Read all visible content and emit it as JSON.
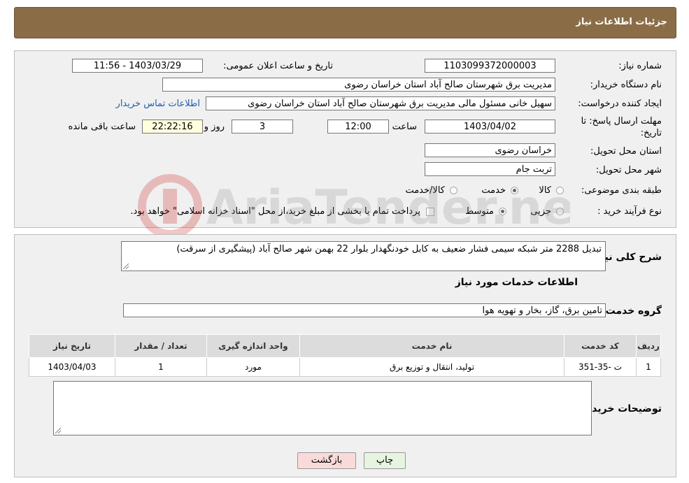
{
  "header": {
    "title": "جزئیات اطلاعات نیاز"
  },
  "form": {
    "need_number": {
      "label": "شماره نیاز:",
      "value": "1103099372000003"
    },
    "announce_datetime": {
      "label": "تاریخ و ساعت اعلان عمومی:",
      "value": "1403/03/29 - 11:56"
    },
    "buyer_org": {
      "label": "نام دستگاه خریدار:",
      "value": "مدیریت برق شهرستان صالح آباد استان خراسان رضوی"
    },
    "requester": {
      "label": "ایجاد کننده درخواست:",
      "value": "سهیل خانی مسئول مالی مدیریت برق شهرستان صالح آباد استان خراسان رضوی",
      "contact_link": "اطلاعات تماس خریدار"
    },
    "deadline": {
      "label": "مهلت ارسال پاسخ: تا تاریخ:",
      "date": "1403/04/02",
      "time_label": "ساعت",
      "time": "12:00",
      "days": "3",
      "days_label": "روز و",
      "remaining": "22:22:16",
      "remaining_label": "ساعت باقی مانده"
    },
    "delivery_province": {
      "label": "استان محل تحویل:",
      "value": "خراسان رضوی"
    },
    "delivery_city": {
      "label": "شهر محل تحویل:",
      "value": "تربت جام"
    },
    "category": {
      "label": "طبقه بندی موضوعی:",
      "options": [
        "کالا",
        "خدمت",
        "کالا/خدمت"
      ],
      "selected": "خدمت"
    },
    "purchase_process": {
      "label": "نوع فرآیند خرید :",
      "options": [
        "جزیی",
        "متوسط"
      ],
      "selected": "متوسط",
      "note": "پرداخت تمام یا بخشی از مبلغ خرید،از محل \"اسناد خزانه اسلامی\" خواهد بود."
    }
  },
  "details": {
    "description_label": "شرح کلی نیاز:",
    "description": "تبدیل 2288 متر شبکه سیمی فشار ضعیف به کابل خودنگهدار بلوار 22 بهمن شهر صالح آباد (پیشگیری از سرقت)",
    "services_title": "اطلاعات خدمات مورد نیاز",
    "service_group_label": "گروه خدمت:",
    "service_group": "تامین برق، گاز، بخار و تهویه هوا",
    "table": {
      "headers": [
        "ردیف",
        "کد خدمت",
        "نام خدمت",
        "واحد اندازه گیری",
        "تعداد / مقدار",
        "تاریخ نیاز"
      ],
      "rows": [
        [
          "1",
          "ت -35-351",
          "تولید، انتقال و توزیع برق",
          "مورد",
          "1",
          "1403/04/03"
        ]
      ]
    },
    "buyer_notes_label": "توضیحات خریدار:",
    "buyer_notes": ""
  },
  "buttons": {
    "print": "چاپ",
    "back": "بازگشت"
  },
  "watermark": {
    "text": "AriaTender.net"
  }
}
